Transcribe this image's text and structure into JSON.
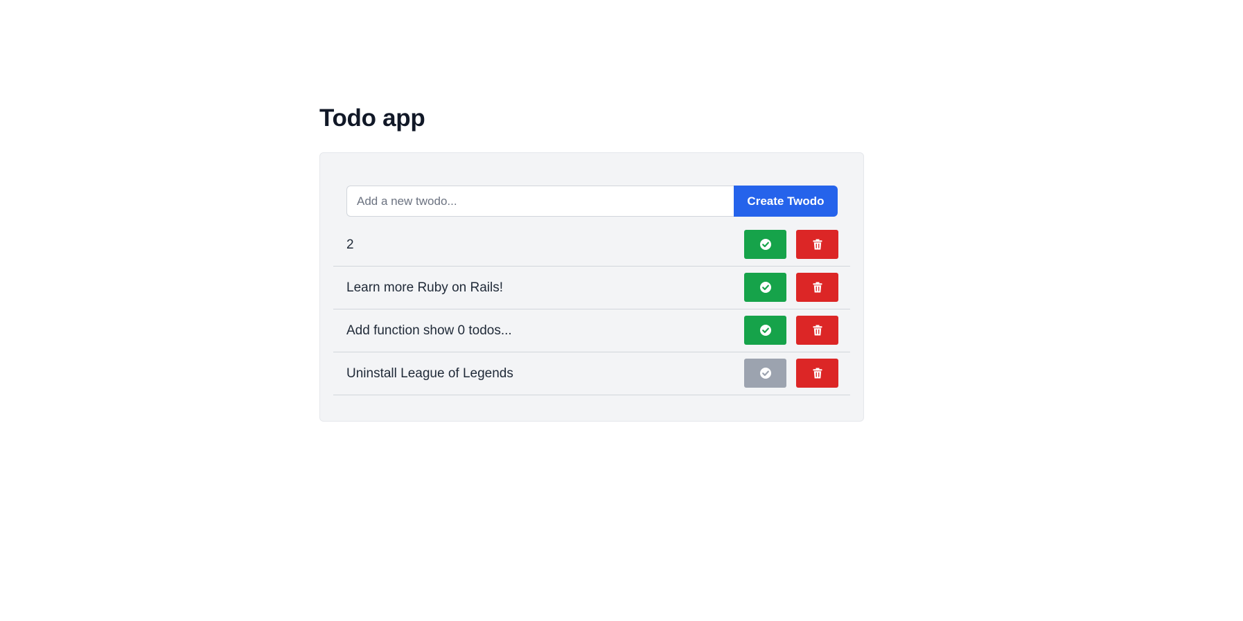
{
  "page": {
    "title": "Todo app"
  },
  "form": {
    "placeholder": "Add a new twodo...",
    "value": "",
    "submit_label": "Create Twodo"
  },
  "todos": [
    {
      "text": "2",
      "completed": false
    },
    {
      "text": "Learn more Ruby on Rails!",
      "completed": false
    },
    {
      "text": "Add function show 0 todos...",
      "completed": false
    },
    {
      "text": "Uninstall League of Legends",
      "completed": true
    }
  ],
  "icons": {
    "complete": "check-circle-icon",
    "delete": "trash-icon"
  },
  "colors": {
    "primary": "#2563eb",
    "success": "#16a34a",
    "danger": "#dc2626",
    "muted": "#9ca3af",
    "panel": "#f3f4f6"
  }
}
